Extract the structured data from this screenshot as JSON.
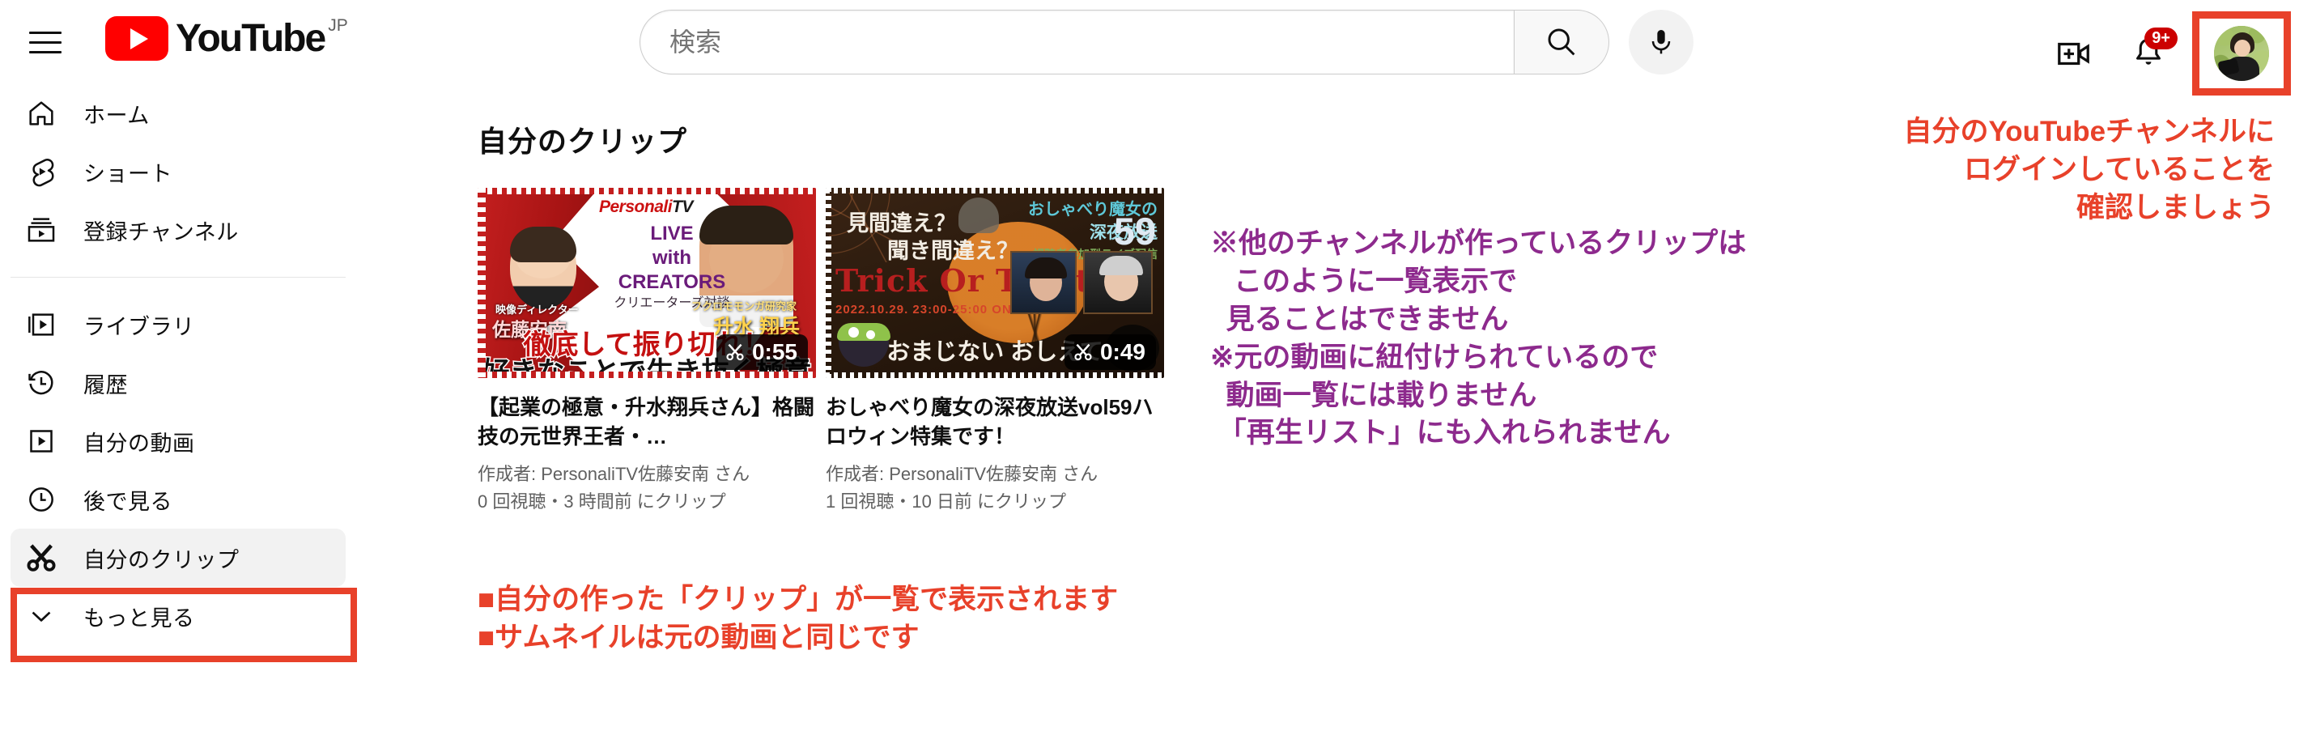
{
  "header": {
    "menu_icon": "hamburger-menu-icon",
    "logo_text": "YouTube",
    "logo_country": "JP",
    "search_placeholder": "検索",
    "search_value": "",
    "search_icon": "search-icon",
    "mic_icon": "microphone-icon",
    "create_icon": "create-video-icon",
    "notifications_icon": "bell-icon",
    "notifications_badge": "9+",
    "avatar_name": "account-avatar"
  },
  "sidebar": {
    "groups": [
      {
        "items": [
          {
            "label": "ホーム",
            "icon": "home-icon",
            "active": false
          },
          {
            "label": "ショート",
            "icon": "shorts-icon",
            "active": false
          },
          {
            "label": "登録チャンネル",
            "icon": "subscriptions-icon",
            "active": false
          }
        ]
      },
      {
        "items": [
          {
            "label": "ライブラリ",
            "icon": "library-icon",
            "active": false
          },
          {
            "label": "履歴",
            "icon": "history-icon",
            "active": false
          },
          {
            "label": "自分の動画",
            "icon": "my-videos-icon",
            "active": false
          },
          {
            "label": "後で見る",
            "icon": "watch-later-icon",
            "active": false
          },
          {
            "label": "自分のクリップ",
            "icon": "scissors-icon",
            "active": true
          },
          {
            "label": "もっと見る",
            "icon": "chevron-down-icon",
            "active": false
          }
        ]
      }
    ]
  },
  "main": {
    "page_title": "自分のクリップ",
    "clips": [
      {
        "title": "【起業の極意・升水翔兵さん】格闘技の元世界王者・…",
        "author": "作成者: PersonaliTV佐藤安南 さん",
        "stats": "0 回視聴・3 時間前 にクリップ",
        "duration": "0:55",
        "duration_icon": "scissors-icon",
        "thumbnail": {
          "brand_personali": "Personali",
          "brand_tv": "TV",
          "brand_reg": "®",
          "live_line1": "LIVE",
          "live_line2": "with",
          "live_line3": "CREATORS",
          "subtitle": "クリエーターズ対談",
          "person_left_role": "映像ディレクター",
          "person_left_name": "佐藤安南",
          "person_right_role": "フクロモモンガ研究家",
          "person_right_name": "升水 翔兵",
          "headline1": "徹底して振り切れ！",
          "headline2": "好きなことで生き抜く極意"
        }
      },
      {
        "title": "おしゃべり魔女の深夜放送vol59ハロウィン特集です！",
        "author": "作成者: PersonaliTV佐藤安南 さん",
        "stats": "1 回視聴・10 日前 にクリップ",
        "duration": "0:49",
        "duration_icon": "scissors-icon",
        "thumbnail": {
          "q1": "見間違え？",
          "q2": "聞き間違え？",
          "trick": "Trick Or Treat",
          "date": "2022.10.29. 23:00-25:00 ON AIR",
          "series1": "おしゃべり魔女の",
          "series2": "深夜放送",
          "series_num": "59",
          "series3": "視聴者参加型ライブ配信",
          "bottom": "おまじない おしえて"
        }
      }
    ]
  },
  "annotations": {
    "login_note": "自分のYouTubeチャンネルに\nログインしていることを\n確認しましょう",
    "clip_note": "※他のチャンネルが作っているクリップは\n   このように一覧表示で\n  見ることはできません\n※元の動画に紐付けられているので\n  動画一覧には載りません\n 「再生リスト」にも入れられません",
    "bullet_note": "■自分の作った「クリップ」が一覧で表示されます\n■サムネイルは元の動画と同じです",
    "color_red": "#e8412a",
    "color_purple": "#8d2a8d"
  }
}
